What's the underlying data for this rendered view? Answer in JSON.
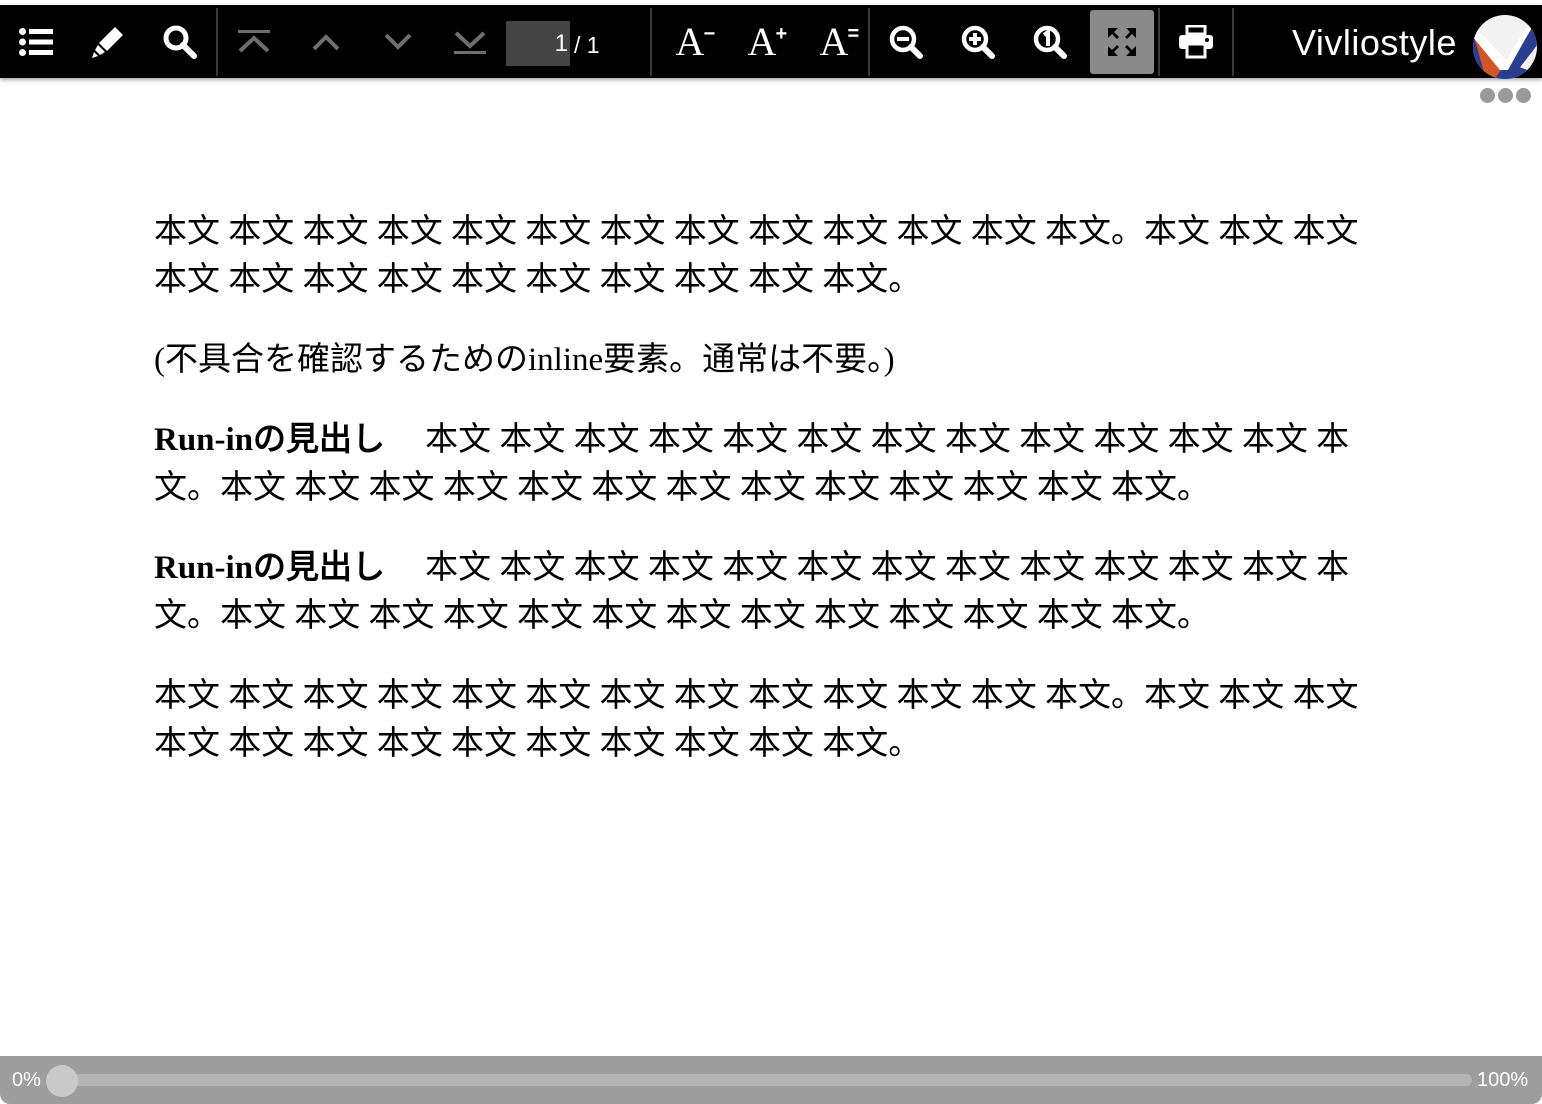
{
  "toolbar": {
    "buttons": {
      "toc": "list-icon",
      "marker": "marker-pen-icon",
      "search": "search-icon",
      "first_page": "first-page-icon",
      "previous_page": "chevron-up-icon",
      "next_page": "chevron-down-icon",
      "last_page": "last-page-icon",
      "font_smaller": "font-size-decrease-icon",
      "font_larger": "font-size-increase-icon",
      "font_default": "font-size-reset-icon",
      "zoom_out": "zoom-out-icon",
      "zoom_in": "zoom-in-icon",
      "zoom_actual": "zoom-actual-size-icon",
      "fit_to_screen": "fit-to-screen-icon",
      "print": "print-icon"
    },
    "font_labels": {
      "letter": "A",
      "smaller": "−",
      "larger": "+",
      "default": "="
    },
    "page_number": "1",
    "page_total": "/ 1",
    "brand_name": "Vivliostyle",
    "active_button": "fit_to_screen",
    "disabled_buttons": [
      "first_page",
      "previous_page",
      "next_page",
      "last_page"
    ]
  },
  "more_menu": "more-dots-icon",
  "content": {
    "para1": "本文 本文 本文 本文 本文 本文 本文 本文 本文 本文 本文 本文 本文。本文 本文 本文 本文 本文 本文 本文 本文 本文 本文 本文 本文 本文。",
    "para2": "(不具合を確認するためのinline要素。通常は不要。)",
    "runin1_heading": "Run-inの見出し",
    "runin1_text": "本文 本文 本文 本文 本文 本文 本文 本文 本文 本文 本文 本文 本文。本文 本文 本文 本文 本文 本文 本文 本文 本文 本文 本文 本文 本文。",
    "runin2_heading": "Run-inの見出し",
    "runin2_text": "本文 本文 本文 本文 本文 本文 本文 本文 本文 本文 本文 本文 本文。本文 本文 本文 本文 本文 本文 本文 本文 本文 本文 本文 本文 本文。",
    "para5": "本文 本文 本文 本文 本文 本文 本文 本文 本文 本文 本文 本文 本文。本文 本文 本文 本文 本文 本文 本文 本文 本文 本文 本文 本文 本文。"
  },
  "progress": {
    "min_label": "0%",
    "max_label": "100%",
    "value": 0
  },
  "colors": {
    "toolbar_bg": "#000000",
    "toolbar_icon": "#ffffff",
    "disabled_icon": "#6e6e6e",
    "active_button_bg": "#8a8a8a",
    "bottombar_bg": "#9e9e9e",
    "logo_red": "#d4542a",
    "logo_blue": "#2a3d8f"
  }
}
